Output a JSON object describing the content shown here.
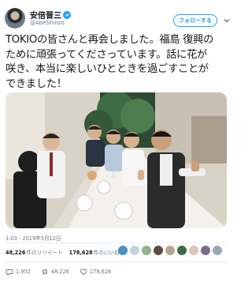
{
  "user": {
    "display_name": "安倍晋三",
    "handle": "@AbeShinzo"
  },
  "follow_button_label": "フォローする",
  "tweet": {
    "lines": [
      "TOKIOの皆さんと再会しました。福島 復興の",
      "ために頑張ってくださっています。話に花が",
      "咲き、本当に楽しいひとときを過ごすことが",
      "できました！"
    ]
  },
  "timestamp": "1:03 - 2019年5月12日",
  "stats": {
    "retweets_count": "48,226",
    "retweets_label": "件のリツイート",
    "likes_count": "178,628",
    "likes_label": "件のいいね"
  },
  "actions": {
    "reply_count": "1,952",
    "retweet_count": "48,226",
    "like_count": "178,628"
  },
  "icons": {
    "verified": "verified-badge-icon",
    "caret": "chevron-down-icon",
    "reply": "reply-icon",
    "retweet": "retweet-icon",
    "like": "heart-icon"
  },
  "colors": {
    "accent": "#1da1f2",
    "muted": "#657786",
    "text": "#14171a",
    "divider": "#e6ecf0"
  }
}
